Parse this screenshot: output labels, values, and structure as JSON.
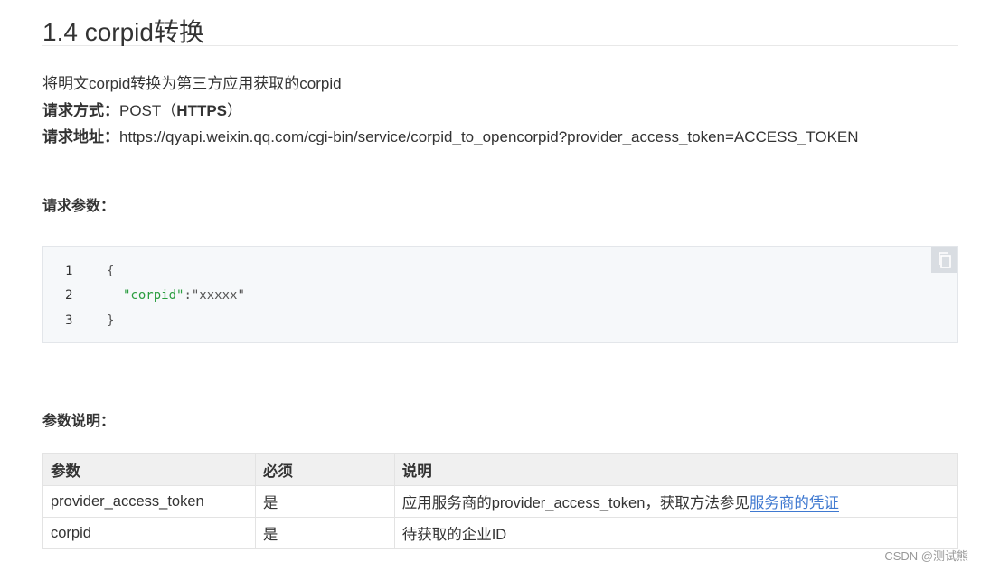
{
  "title": "1.4 corpid转换",
  "description": "将明文corpid转换为第三方应用获取的corpid",
  "request_method": {
    "label": "请求方式",
    "colon": "：",
    "method": "POST（",
    "protocol": "HTTPS",
    "close": "）"
  },
  "request_url": {
    "label": "请求地址",
    "colon": "：",
    "url": "https://qyapi.weixin.qq.com/cgi-bin/service/corpid_to_opencorpid?provider_access_token=ACCESS_TOKEN"
  },
  "request_params_label": "请求参数：",
  "code": {
    "lines": [
      {
        "num": "1",
        "text": "{"
      },
      {
        "num": "2",
        "key": "\"corpid\"",
        "sep": ":",
        "value": "\"xxxxx\""
      },
      {
        "num": "3",
        "text": "}"
      }
    ],
    "copy_icon": "copy-icon"
  },
  "param_desc_label": "参数说明：",
  "table": {
    "headers": [
      "参数",
      "必须",
      "说明"
    ],
    "rows": [
      {
        "param": "provider_access_token",
        "required": "是",
        "desc": "应用服务商的provider_access_token，获取方法参见",
        "link": "服务商的凭证"
      },
      {
        "param": "corpid",
        "required": "是",
        "desc": "待获取的企业ID",
        "link": ""
      }
    ]
  },
  "watermark": "CSDN @测试熊",
  "colors": {
    "link": "#3e78d0",
    "string": "#2a9d3f",
    "code_bg": "#f6f8fa",
    "header_bg": "#f0f0f0"
  }
}
